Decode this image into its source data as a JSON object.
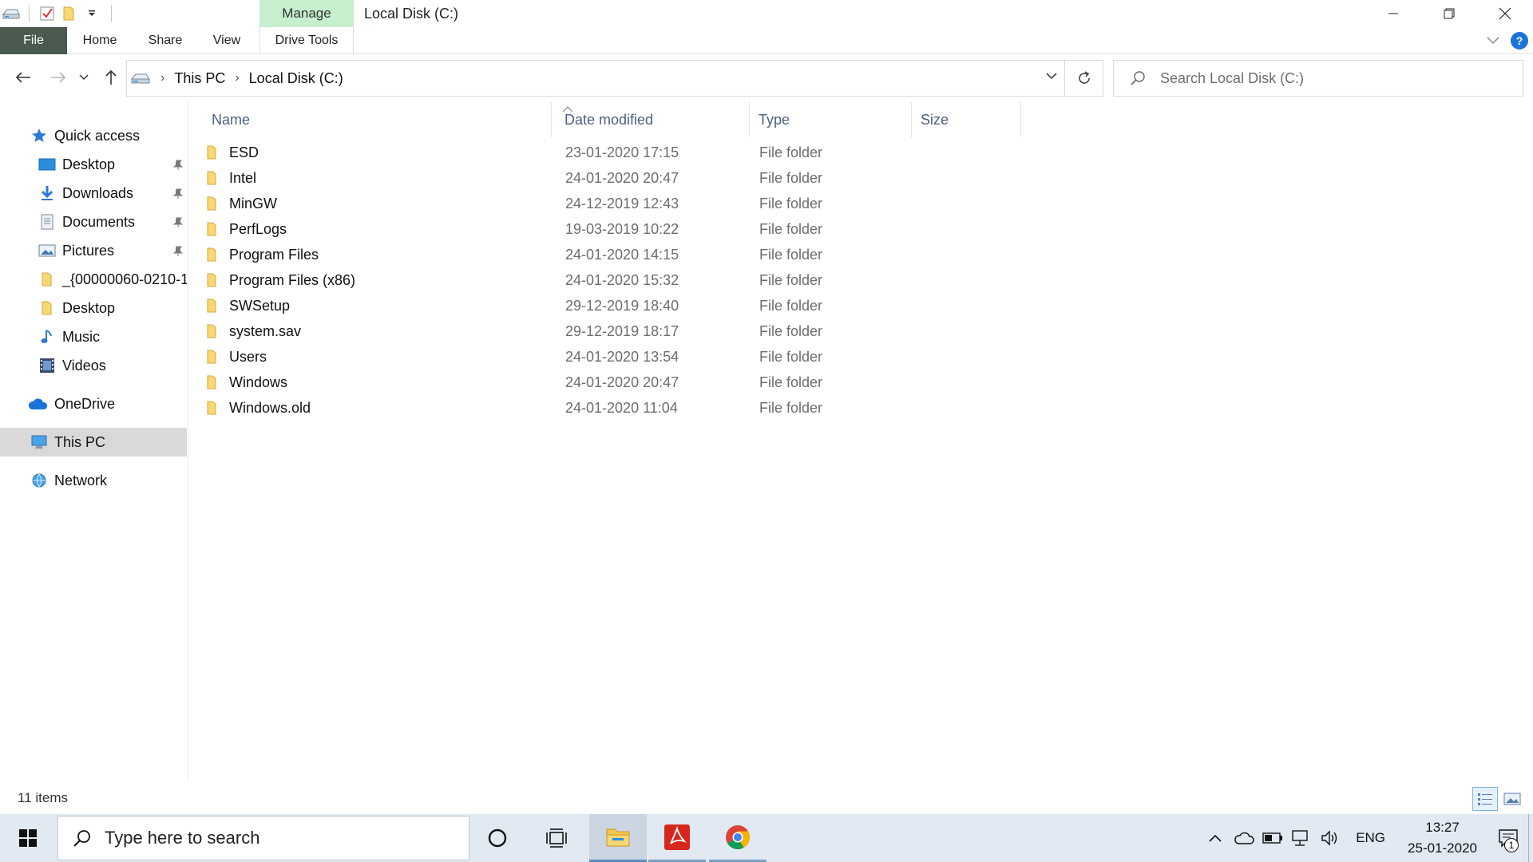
{
  "titlebar": {
    "manage_tab": "Manage",
    "title": "Local Disk (C:)"
  },
  "ribbon": {
    "tabs": [
      "File",
      "Home",
      "Share",
      "View",
      "Drive Tools"
    ]
  },
  "address": {
    "segments": [
      "This PC",
      "Local Disk (C:)"
    ]
  },
  "search": {
    "placeholder": "Search Local Disk (C:)"
  },
  "navpane": {
    "quick_access": "Quick access",
    "pinned": [
      "Desktop",
      "Downloads",
      "Documents",
      "Pictures"
    ],
    "recent": [
      "_{00000060-0210-1",
      "Desktop",
      "Music",
      "Videos"
    ],
    "onedrive": "OneDrive",
    "this_pc": "This PC",
    "network": "Network"
  },
  "columns": [
    "Name",
    "Date modified",
    "Type",
    "Size"
  ],
  "files": [
    {
      "name": "ESD",
      "date": "23-01-2020 17:15",
      "type": "File folder"
    },
    {
      "name": "Intel",
      "date": "24-01-2020 20:47",
      "type": "File folder"
    },
    {
      "name": "MinGW",
      "date": "24-12-2019 12:43",
      "type": "File folder"
    },
    {
      "name": "PerfLogs",
      "date": "19-03-2019 10:22",
      "type": "File folder"
    },
    {
      "name": "Program Files",
      "date": "24-01-2020 14:15",
      "type": "File folder"
    },
    {
      "name": "Program Files (x86)",
      "date": "24-01-2020 15:32",
      "type": "File folder"
    },
    {
      "name": "SWSetup",
      "date": "29-12-2019 18:40",
      "type": "File folder"
    },
    {
      "name": "system.sav",
      "date": "29-12-2019 18:17",
      "type": "File folder"
    },
    {
      "name": "Users",
      "date": "24-01-2020 13:54",
      "type": "File folder"
    },
    {
      "name": "Windows",
      "date": "24-01-2020 20:47",
      "type": "File folder"
    },
    {
      "name": "Windows.old",
      "date": "24-01-2020 11:04",
      "type": "File folder"
    }
  ],
  "status": {
    "item_count": "11 items"
  },
  "taskbar": {
    "search_placeholder": "Type here to search",
    "language": "ENG",
    "time": "13:27",
    "date": "25-01-2020",
    "notification_count": "1"
  },
  "colors": {
    "file_tab": "#4a5a4e",
    "manage_tab": "#c6efce",
    "selected_nav": "#d9d9d9",
    "column_header_text": "#4d6082",
    "folder_yellow": "#f8d775",
    "taskbar": "#e1e9f2"
  }
}
